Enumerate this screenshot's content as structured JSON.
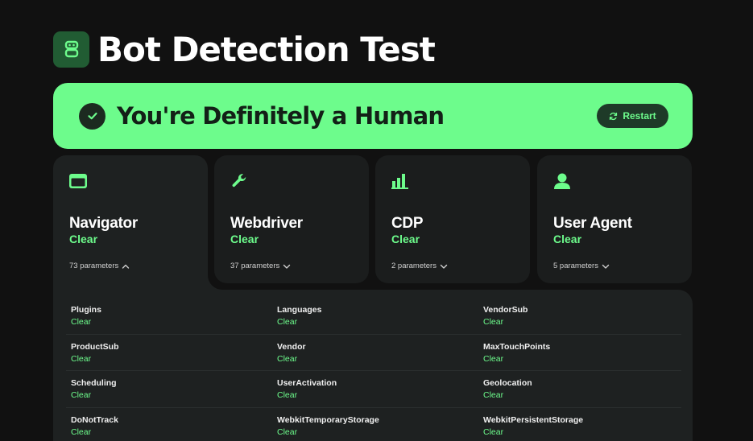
{
  "header": {
    "title": "Bot Detection Test",
    "logo_icon": "robot-icon"
  },
  "banner": {
    "text": "You're Definitely a Human",
    "restart_label": "Restart",
    "icon": "check-circle-icon"
  },
  "colors": {
    "accent": "#6dfc8c",
    "background": "#111111",
    "card": "#1b1d1d"
  },
  "cards": [
    {
      "icon": "browser-window-icon",
      "title": "Navigator",
      "status": "Clear",
      "params": "73 parameters",
      "expanded": true
    },
    {
      "icon": "wrench-icon",
      "title": "Webdriver",
      "status": "Clear",
      "params": "37 parameters",
      "expanded": false
    },
    {
      "icon": "bar-chart-icon",
      "title": "CDP",
      "status": "Clear",
      "params": "2 parameters",
      "expanded": false
    },
    {
      "icon": "user-icon",
      "title": "User Agent",
      "status": "Clear",
      "params": "5 parameters",
      "expanded": false
    }
  ],
  "parameters": [
    {
      "name": "Plugins",
      "status": "Clear"
    },
    {
      "name": "Languages",
      "status": "Clear"
    },
    {
      "name": "VendorSub",
      "status": "Clear"
    },
    {
      "name": "ProductSub",
      "status": "Clear"
    },
    {
      "name": "Vendor",
      "status": "Clear"
    },
    {
      "name": "MaxTouchPoints",
      "status": "Clear"
    },
    {
      "name": "Scheduling",
      "status": "Clear"
    },
    {
      "name": "UserActivation",
      "status": "Clear"
    },
    {
      "name": "Geolocation",
      "status": "Clear"
    },
    {
      "name": "DoNotTrack",
      "status": "Clear"
    },
    {
      "name": "WebkitTemporaryStorage",
      "status": "Clear"
    },
    {
      "name": "WebkitPersistentStorage",
      "status": "Clear"
    }
  ]
}
